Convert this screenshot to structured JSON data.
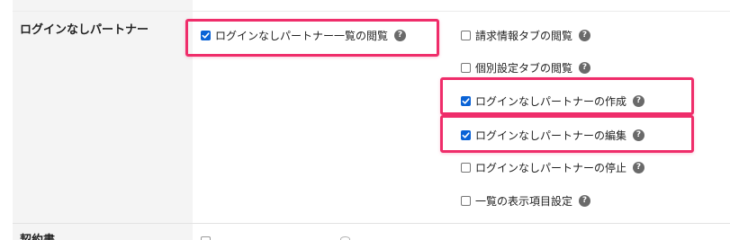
{
  "section": {
    "title": "ログインなしパートナー"
  },
  "left_permission": {
    "label": "ログインなしパートナー一覧の閲覧",
    "checked": true,
    "highlighted": true
  },
  "right_permissions": [
    {
      "label": "請求情報タブの閲覧",
      "checked": false,
      "highlighted": false
    },
    {
      "label": "個別設定タブの閲覧",
      "checked": false,
      "highlighted": false
    },
    {
      "label": "ログインなしパートナーの作成",
      "checked": true,
      "highlighted": true
    },
    {
      "label": "ログインなしパートナーの編集",
      "checked": true,
      "highlighted": true
    },
    {
      "label": "ログインなしパートナーの停止",
      "checked": false,
      "highlighted": false
    },
    {
      "label": "一覧の表示項目設定",
      "checked": false,
      "highlighted": false
    }
  ],
  "next_section": {
    "title": "契約書"
  },
  "icons": {
    "help": "question-circle-icon",
    "checkbox_checked": "checkmark-icon"
  },
  "colors": {
    "highlight": "#ef2d6a",
    "checkbox_checked": "#0a63d6",
    "label_column_bg": "#f4f4f4",
    "help_icon": "#6a6a6a"
  }
}
